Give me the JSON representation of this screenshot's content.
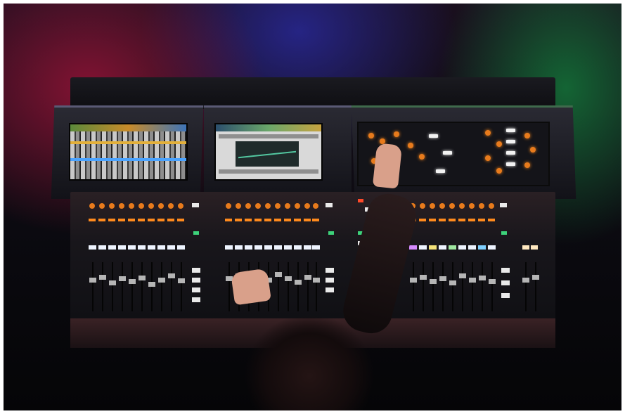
{
  "scene": {
    "subject": "photo",
    "accent_colors": {
      "left_glow": "#96143a",
      "center_glow": "#28288f",
      "right_glow": "#146e37",
      "knob_led": "#e87b1c",
      "channel_led": "#f2f2f2",
      "meter_blue": "#4aa3ff"
    },
    "icons": [
      "mixing-console",
      "touch-screen",
      "fader",
      "knob",
      "hand"
    ]
  }
}
